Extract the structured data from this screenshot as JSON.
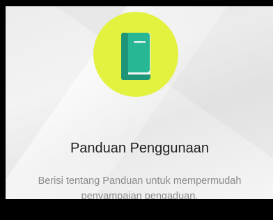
{
  "card": {
    "icon": "manual-book-icon",
    "book_label": "MANUAL BOOK",
    "title": "Panduan Penggunaan",
    "description_lines": [
      "Berisi tentang Panduan untuk mempermudah",
      "penyampaian pengaduan."
    ]
  },
  "colors": {
    "icon_circle": "#e3f13f",
    "book_cover": "#27b795",
    "book_spine": "#1e9478"
  }
}
